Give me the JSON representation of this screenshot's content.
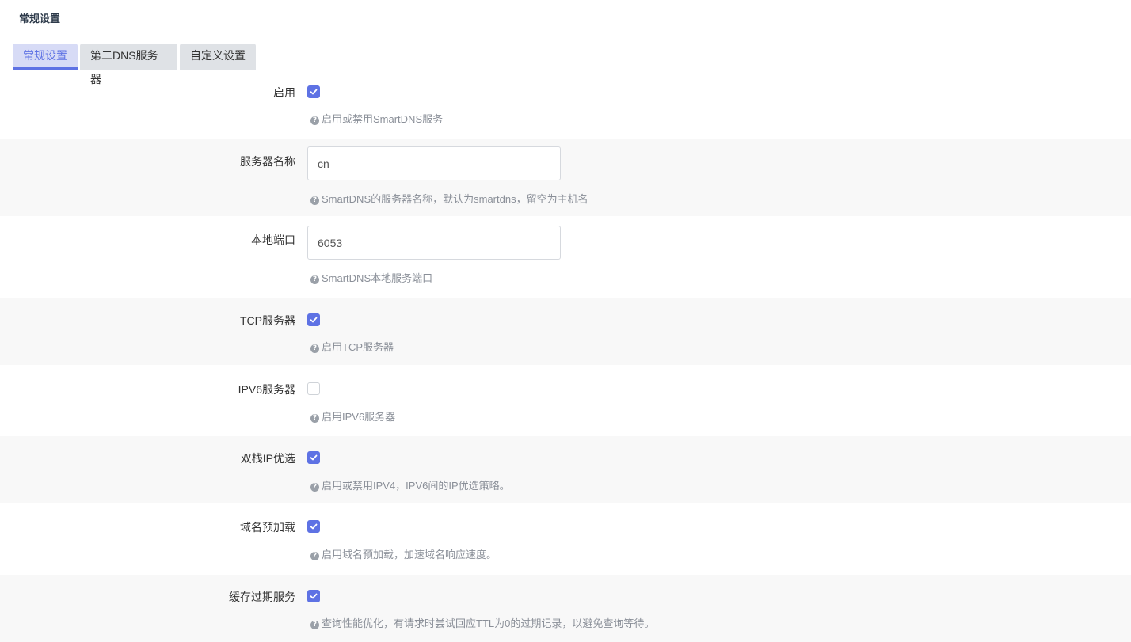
{
  "section": {
    "title": "常规设置"
  },
  "tabs": [
    {
      "label": "常规设置",
      "active": true
    },
    {
      "label": "第二DNS服务器",
      "active": false
    },
    {
      "label": "自定义设置",
      "active": false
    }
  ],
  "fields": {
    "enable": {
      "label": "启用",
      "checked": true,
      "help": "启用或禁用SmartDNS服务"
    },
    "server_name": {
      "label": "服务器名称",
      "value": "cn",
      "help": "SmartDNS的服务器名称，默认为smartdns，留空为主机名"
    },
    "local_port": {
      "label": "本地端口",
      "value": "6053",
      "help": "SmartDNS本地服务端口"
    },
    "tcp_server": {
      "label": "TCP服务器",
      "checked": true,
      "help": "启用TCP服务器"
    },
    "ipv6_server": {
      "label": "IPV6服务器",
      "checked": false,
      "help": "启用IPV6服务器"
    },
    "dualstack_ip": {
      "label": "双栈IP优选",
      "checked": true,
      "help": "启用或禁用IPV4，IPV6间的IP优选策略。"
    },
    "prefetch": {
      "label": "域名预加载",
      "checked": true,
      "help": "启用域名预加载，加速域名响应速度。"
    },
    "serve_expired": {
      "label": "缓存过期服务",
      "checked": true,
      "help": "查询性能优化，有请求时尝试回应TTL为0的过期记录，以避免查询等待。"
    }
  },
  "colors": {
    "accent": "#5e72e4",
    "tab_active_bg": "#d7dbf6",
    "tab_bg": "#dfe2e6",
    "row_shade": "#f8f8f8",
    "help_text": "#8a8f98"
  },
  "icons": {
    "help": "question-circle-icon",
    "check": "checkmark-icon"
  }
}
